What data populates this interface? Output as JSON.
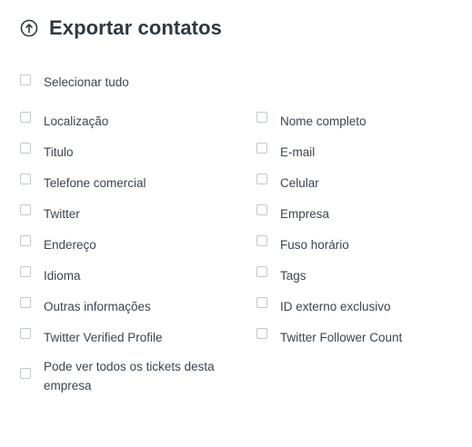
{
  "header": {
    "icon": "upload-circle-icon",
    "title": "Exportar contatos"
  },
  "select_all": {
    "label": "Selecionar tudo",
    "checked": false
  },
  "left_column": [
    {
      "label": "Localização",
      "checked": false
    },
    {
      "label": "Titulo",
      "checked": false
    },
    {
      "label": "Telefone comercial",
      "checked": false
    },
    {
      "label": "Twitter",
      "checked": false
    },
    {
      "label": "Endereço",
      "checked": false
    },
    {
      "label": "Idioma",
      "checked": false
    },
    {
      "label": "Outras informações",
      "checked": false
    },
    {
      "label": "Twitter Verified Profile",
      "checked": false
    },
    {
      "label": "Pode ver todos os tickets desta empresa",
      "checked": false
    }
  ],
  "right_column": [
    {
      "label": "Nome completo",
      "checked": false
    },
    {
      "label": "E-mail",
      "checked": false
    },
    {
      "label": "Celular",
      "checked": false
    },
    {
      "label": "Empresa",
      "checked": false
    },
    {
      "label": "Fuso horário",
      "checked": false
    },
    {
      "label": "Tags",
      "checked": false
    },
    {
      "label": "ID externo exclusivo",
      "checked": false
    },
    {
      "label": "Twitter Follower Count",
      "checked": false
    }
  ]
}
